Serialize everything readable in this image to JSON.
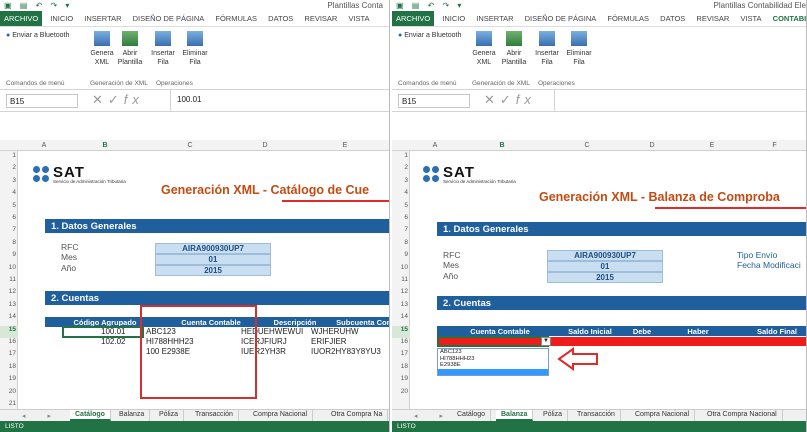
{
  "left": {
    "window_title": "Plantillas Conta",
    "ribbon_tabs": [
      "ARCHIVO",
      "INICIO",
      "INSERTAR",
      "DISEÑO DE PÁGINA",
      "FÓRMULAS",
      "DATOS",
      "REVISAR",
      "VISTA"
    ],
    "bluetooth_label": "Enviar a Bluetooth",
    "buttons": {
      "genera": "Genera\nXML",
      "abrir": "Abrir\nPlantilla",
      "insertar": "Insertar\nFila",
      "eliminar": "Eliminar\nFila"
    },
    "groups": {
      "menu": "Comandos de menú",
      "gen": "Generación de XML",
      "ops": "Operaciones"
    },
    "name_box": "B15",
    "formula_value": "100.01",
    "columns": [
      "A",
      "B",
      "C",
      "D",
      "E"
    ],
    "rows": [
      "1",
      "2",
      "3",
      "4",
      "5",
      "6",
      "7",
      "8",
      "9",
      "10",
      "11",
      "12",
      "13",
      "14",
      "15",
      "16",
      "17",
      "18",
      "19",
      "20",
      "21"
    ],
    "logo": {
      "text": "SAT",
      "sub": "Servicio de Administración Tributaria"
    },
    "title_prefix": "Generación XML - ",
    "title_suffix": "Catálogo de Cue",
    "section1": "1. Datos Generales",
    "rfc_label": "RFC",
    "rfc_value": "AIRA900930UP7",
    "mes_label": "Mes",
    "mes_value": "01",
    "anio_label": "Año",
    "anio_value": "2015",
    "section2": "2. Cuentas",
    "table_headers": [
      "Código Agrupado",
      "Cuenta Contable",
      "Descripción",
      "Subcuenta Conta"
    ],
    "table_rows": [
      [
        "100.01",
        "ABC123",
        "HEDUEHWEWUI",
        "WJHERUHW"
      ],
      [
        "102.02",
        "HI788HHH23",
        "ICERJFIURJ",
        "ERIFJIER"
      ],
      [
        "",
        "100 E2938E",
        "IUER2YH3R",
        "IUOR2HY83Y8YU3"
      ]
    ],
    "sheet_tabs": [
      "Catálogo",
      "Balanza",
      "Póliza",
      "Transacción",
      "Compra Nacional",
      "Otra Compra Na"
    ],
    "status": "LISTO"
  },
  "right": {
    "window_title": "Plantillas Contabilidad Ele",
    "ribbon_tabs": [
      "ARCHIVO",
      "INICIO",
      "INSERTAR",
      "DISEÑO DE PÁGINA",
      "FÓRMULAS",
      "DATOS",
      "REVISAR",
      "VISTA",
      "CONTABILID"
    ],
    "bluetooth_label": "Enviar a Bluetooth",
    "buttons": {
      "genera": "Genera\nXML",
      "abrir": "Abrir\nPlantilla",
      "insertar": "Insertar\nFila",
      "eliminar": "Eliminar\nFila"
    },
    "groups": {
      "menu": "Comandos de menú",
      "gen": "Generación de XML",
      "ops": "Operaciones"
    },
    "name_box": "B15",
    "formula_value": "",
    "columns": [
      "A",
      "B",
      "C",
      "D",
      "E",
      "F"
    ],
    "rows": [
      "1",
      "2",
      "3",
      "4",
      "5",
      "6",
      "7",
      "8",
      "9",
      "10",
      "11",
      "12",
      "13",
      "14",
      "15",
      "16",
      "17",
      "18",
      "19",
      "20"
    ],
    "logo": {
      "text": "SAT",
      "sub": "Servicio de Administración Tributaria"
    },
    "title_prefix": "Generación XML - ",
    "title_suffix": "Balanza de Comproba",
    "section1": "1. Datos Generales",
    "rfc_label": "RFC",
    "rfc_value": "AIRA900930UP7",
    "mes_label": "Mes",
    "mes_value": "01",
    "anio_label": "Año",
    "anio_value": "2015",
    "tipo_envio": "Tipo Envío",
    "fecha_mod": "Fecha Modificaci",
    "section2": "2. Cuentas",
    "table_headers": [
      "Cuenta Contable",
      "Saldo Inicial",
      "Debe",
      "Haber",
      "Saldo Final"
    ],
    "dropdown_options": [
      "ABC123",
      "HI788HHH23",
      "E2938E"
    ],
    "sheet_tabs": [
      "Catálogo",
      "Balanza",
      "Póliza",
      "Transacción",
      "Compra Nacional",
      "Otra Compra Nacional"
    ],
    "status": "LISTO"
  },
  "colors": {
    "excel_green": "#217346",
    "header_blue": "#1f5f9e",
    "title_orange": "#c44b12",
    "highlight_red": "#e02b2b"
  }
}
